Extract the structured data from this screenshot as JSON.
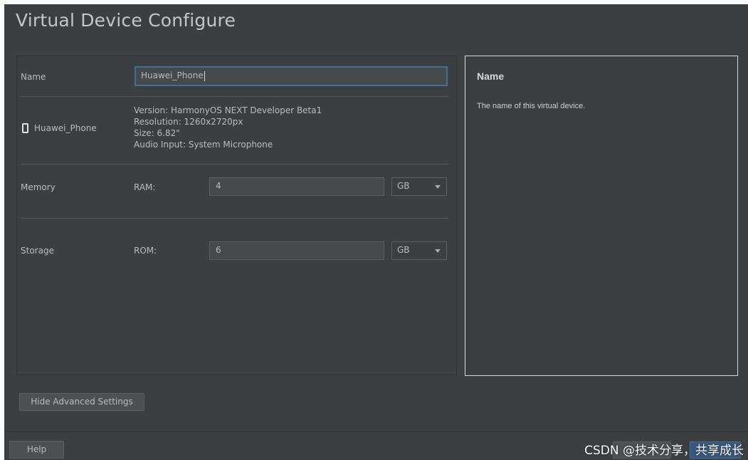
{
  "dialog": {
    "title": "Virtual Device Configure"
  },
  "form": {
    "name_label": "Name",
    "name_value": "Huawei_Phone",
    "device": {
      "icon": "phone-icon",
      "name": "Huawei_Phone",
      "version": "Version: HarmonyOS NEXT Developer Beta1",
      "resolution": "Resolution: 1260x2720px",
      "size": "Size: 6.82\"",
      "audio": "Audio Input: System Microphone"
    },
    "memory": {
      "label": "Memory",
      "field_label": "RAM:",
      "value": "4",
      "unit": "GB"
    },
    "storage": {
      "label": "Storage",
      "field_label": "ROM:",
      "value": "6",
      "unit": "GB"
    }
  },
  "help_panel": {
    "title": "Name",
    "description": "The name of this virtual device."
  },
  "buttons": {
    "hide_advanced": "Hide Advanced Settings",
    "help": "Help"
  },
  "watermark": "CSDN @技术分享，共享成长",
  "colors": {
    "background": "#3c3f41",
    "focus_border": "#466d94",
    "primary_button": "#365880"
  }
}
